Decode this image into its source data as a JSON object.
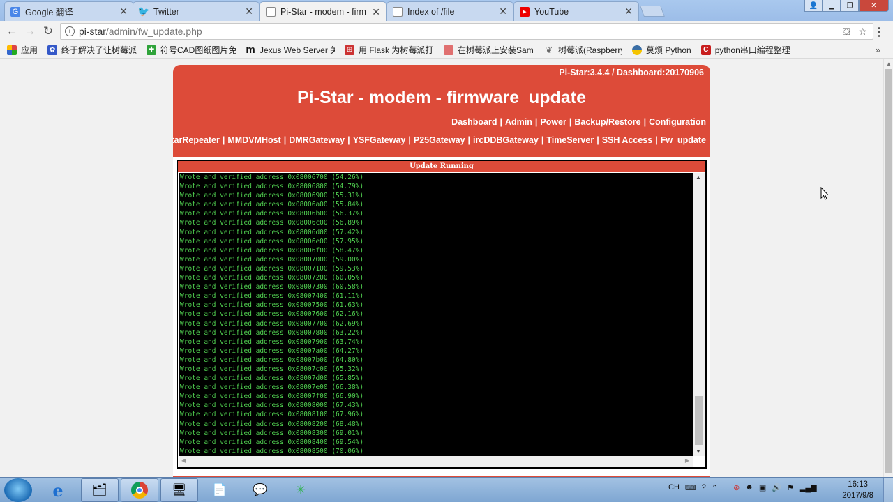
{
  "browser": {
    "tabs": [
      {
        "title": "Google 翻译",
        "icon": "google-icon",
        "active": false
      },
      {
        "title": "Twitter",
        "icon": "twitter-icon",
        "active": false
      },
      {
        "title": "Pi-Star - modem - firm",
        "icon": "page-icon",
        "active": true
      },
      {
        "title": "Index of /file",
        "icon": "page-icon",
        "active": false
      },
      {
        "title": "YouTube",
        "icon": "youtube-icon",
        "active": false
      }
    ],
    "url_host": "pi-star",
    "url_path": "/admin/fw_update.php",
    "bookmarks": [
      {
        "label": "应用",
        "icon": "apps-grid-icon",
        "color": "#d44"
      },
      {
        "label": "终于解决了让树莓派...",
        "icon": "paw-icon",
        "color": "#3458c8"
      },
      {
        "label": "符号CAD图纸图片免...",
        "icon": "plus-icon",
        "color": "#2fa33a"
      },
      {
        "label": "Jexus Web Server 关",
        "icon": "m-icon",
        "color": "#111"
      },
      {
        "label": "用 Flask 为树莓派打...",
        "icon": "robot-icon",
        "color": "#c33"
      },
      {
        "label": "在树莓派上安装Saml",
        "icon": "page-icon",
        "color": "#e07070"
      },
      {
        "label": "树莓派(Raspberry Pi",
        "icon": "feather-icon",
        "color": "#666"
      },
      {
        "label": "莫烦 Python",
        "icon": "python-icon",
        "color": "#3a6ea5"
      },
      {
        "label": "python串口编程整理",
        "icon": "c-icon",
        "color": "#c81e1e"
      }
    ]
  },
  "page": {
    "version": "Pi-Star:3.4.4 / Dashboard:20170906",
    "title": "Pi-Star - modem - firmware_update",
    "nav_primary": [
      "Dashboard",
      "Admin",
      "Power",
      "Backup/Restore",
      "Configuration"
    ],
    "nav_secondary": [
      "DStarRepeater",
      "MMDVMHost",
      "DMRGateway",
      "YSFGateway",
      "P25Gateway",
      "ircDDBGateway",
      "TimeServer",
      "SSH Access",
      "Fw_update"
    ],
    "console_title": "Update Running",
    "log_prefix": "Wrote and verified address",
    "log": [
      [
        "0x08006700",
        "(54.26%)"
      ],
      [
        "0x08006800",
        "(54.79%)"
      ],
      [
        "0x08006900",
        "(55.31%)"
      ],
      [
        "0x08006a00",
        "(55.84%)"
      ],
      [
        "0x08006b00",
        "(56.37%)"
      ],
      [
        "0x08006c00",
        "(56.89%)"
      ],
      [
        "0x08006d00",
        "(57.42%)"
      ],
      [
        "0x08006e00",
        "(57.95%)"
      ],
      [
        "0x08006f00",
        "(58.47%)"
      ],
      [
        "0x08007000",
        "(59.00%)"
      ],
      [
        "0x08007100",
        "(59.53%)"
      ],
      [
        "0x08007200",
        "(60.05%)"
      ],
      [
        "0x08007300",
        "(60.58%)"
      ],
      [
        "0x08007400",
        "(61.11%)"
      ],
      [
        "0x08007500",
        "(61.63%)"
      ],
      [
        "0x08007600",
        "(62.16%)"
      ],
      [
        "0x08007700",
        "(62.69%)"
      ],
      [
        "0x08007800",
        "(63.22%)"
      ],
      [
        "0x08007900",
        "(63.74%)"
      ],
      [
        "0x08007a00",
        "(64.27%)"
      ],
      [
        "0x08007b00",
        "(64.80%)"
      ],
      [
        "0x08007c00",
        "(65.32%)"
      ],
      [
        "0x08007d00",
        "(65.85%)"
      ],
      [
        "0x08007e00",
        "(66.38%)"
      ],
      [
        "0x08007f00",
        "(66.90%)"
      ],
      [
        "0x08008000",
        "(67.43%)"
      ],
      [
        "0x08008100",
        "(67.96%)"
      ],
      [
        "0x08008200",
        "(68.48%)"
      ],
      [
        "0x08008300",
        "(69.01%)"
      ],
      [
        "0x08008400",
        "(69.54%)"
      ],
      [
        "0x08008500",
        "(70.06%)"
      ]
    ]
  },
  "taskbar": {
    "tray_lang": "CH",
    "time": "16:13",
    "date": "2017/9/8"
  },
  "colors": {
    "brand": "#dd4b39",
    "console_text": "#50d050"
  }
}
